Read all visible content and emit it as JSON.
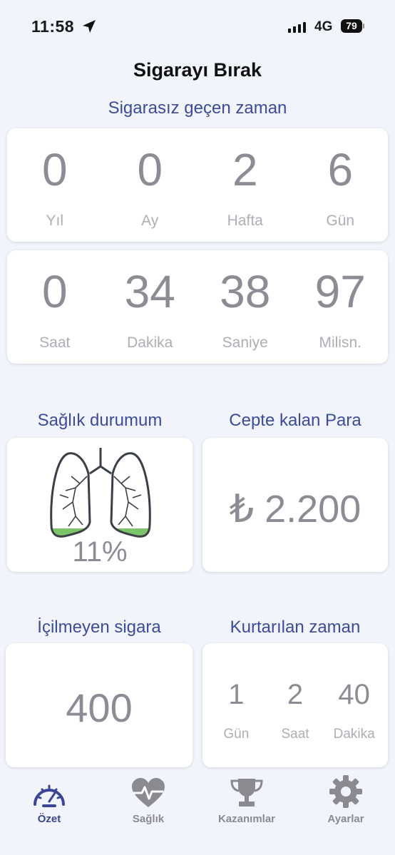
{
  "status": {
    "time": "11:58",
    "network": "4G",
    "battery": "79"
  },
  "header": {
    "title": "Sigarayı Bırak"
  },
  "elapsed": {
    "label": "Sigarasız geçen zaman",
    "row1": [
      {
        "value": "0",
        "unit": "Yıl"
      },
      {
        "value": "0",
        "unit": "Ay"
      },
      {
        "value": "2",
        "unit": "Hafta"
      },
      {
        "value": "6",
        "unit": "Gün"
      }
    ],
    "row2": [
      {
        "value": "0",
        "unit": "Saat"
      },
      {
        "value": "34",
        "unit": "Dakika"
      },
      {
        "value": "38",
        "unit": "Saniye"
      },
      {
        "value": "97",
        "unit": "Milisn."
      }
    ]
  },
  "health": {
    "label": "Sağlık durumum",
    "percent": "11%",
    "fill_fraction": 0.11,
    "fill_color": "#7cc46a"
  },
  "money": {
    "label": "Cepte kalan Para",
    "value": "₺ 2.200"
  },
  "cigarettes": {
    "label": "İçilmeyen sigara",
    "value": "400"
  },
  "saved_time": {
    "label": "Kurtarılan zaman",
    "items": [
      {
        "value": "1",
        "unit": "Gün"
      },
      {
        "value": "2",
        "unit": "Saat"
      },
      {
        "value": "40",
        "unit": "Dakika"
      }
    ]
  },
  "tabs": [
    {
      "label": "Özet",
      "icon": "speedometer-icon",
      "active": true
    },
    {
      "label": "Sağlık",
      "icon": "heart-pulse-icon",
      "active": false
    },
    {
      "label": "Kazanımlar",
      "icon": "trophy-icon",
      "active": false
    },
    {
      "label": "Ayarlar",
      "icon": "gear-icon",
      "active": false
    }
  ],
  "colors": {
    "accent": "#3a4596",
    "label": "#3c4aa0",
    "value_gray": "#8c8c94",
    "inactive": "#8a8a90",
    "background": "#f1f4fb"
  }
}
